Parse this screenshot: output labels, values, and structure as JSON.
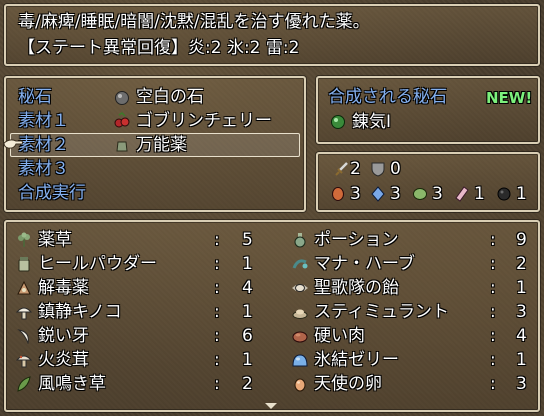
{
  "help": {
    "line1": "毒/麻痺/睡眠/暗闇/沈黙/混乱を治す優れた薬。",
    "line2": "【ステート異常回復】炎:2 氷:2 雷:2"
  },
  "menu": {
    "items": [
      {
        "label": "秘石",
        "value": "空白の石",
        "icon": "grey-orb-icon"
      },
      {
        "label": "素材１",
        "value": "ゴブリンチェリー",
        "icon": "cherry-icon"
      },
      {
        "label": "素材２",
        "value": "万能薬",
        "icon": "potion-jar-icon"
      },
      {
        "label": "素材３",
        "value": "",
        "icon": ""
      },
      {
        "label": "合成実行",
        "value": "",
        "icon": ""
      }
    ],
    "selected_index": 2
  },
  "result": {
    "title": "合成される秘石",
    "badge": "NEW!",
    "item": "錬気Ⅰ",
    "icon": "green-orb-icon"
  },
  "stats": {
    "row1": [
      {
        "icon": "sword-icon",
        "value": "2"
      },
      {
        "icon": "shield-icon",
        "value": "0"
      }
    ],
    "row2": [
      {
        "icon": "red-gem-icon",
        "value": "3"
      },
      {
        "icon": "blue-crystal-icon",
        "value": "3"
      },
      {
        "icon": "green-gem-icon",
        "value": "3"
      },
      {
        "icon": "pink-crystal-icon",
        "value": "1"
      },
      {
        "icon": "dark-orb-icon",
        "value": "1"
      }
    ]
  },
  "inventory": {
    "colon": ":",
    "left": [
      {
        "name": "薬草",
        "count": "5",
        "icon": "herb-icon"
      },
      {
        "name": "ヒールパウダー",
        "count": "1",
        "icon": "powder-jar-icon"
      },
      {
        "name": "解毒薬",
        "count": "4",
        "icon": "antidote-icon"
      },
      {
        "name": "鎮静キノコ",
        "count": "1",
        "icon": "mushroom-white-icon"
      },
      {
        "name": "鋭い牙",
        "count": "6",
        "icon": "fang-icon"
      },
      {
        "name": "火炎茸",
        "count": "1",
        "icon": "mushroom-fire-icon"
      },
      {
        "name": "風鳴き草",
        "count": "2",
        "icon": "leaf-icon"
      }
    ],
    "right": [
      {
        "name": "ポーション",
        "count": "9",
        "icon": "potion-icon"
      },
      {
        "name": "マナ・ハーブ",
        "count": "2",
        "icon": "mana-herb-icon"
      },
      {
        "name": "聖歌隊の飴",
        "count": "1",
        "icon": "candy-icon"
      },
      {
        "name": "スティミュラント",
        "count": "3",
        "icon": "stimulant-icon"
      },
      {
        "name": "硬い肉",
        "count": "4",
        "icon": "meat-icon"
      },
      {
        "name": "氷結ゼリー",
        "count": "1",
        "icon": "ice-jelly-icon"
      },
      {
        "name": "天使の卵",
        "count": "3",
        "icon": "egg-icon"
      }
    ]
  },
  "colors": {
    "system_text": "#84b0f0",
    "new_badge": "#7cf07c",
    "window_border": "#d9ceb4"
  }
}
